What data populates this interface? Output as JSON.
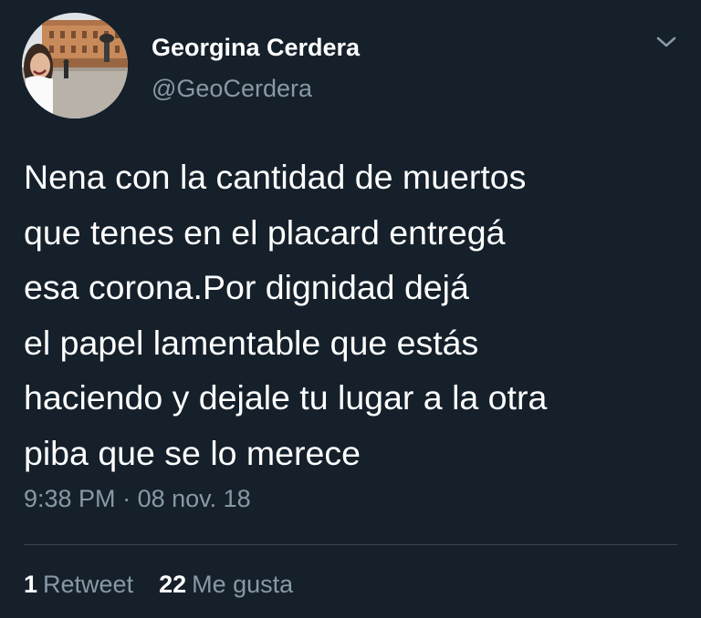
{
  "author": {
    "display_name": "Georgina Cerdera",
    "handle": "@GeoCerdera"
  },
  "tweet": {
    "text": "Nena con la cantidad de muertos\nque tenes en el placard entregá\nesa corona.Por dignidad dejá\nel papel lamentable que estás\nhaciendo y dejale tu lugar a la otra\npiba que se lo merece",
    "time": "9:38 PM",
    "separator": "·",
    "date": "08 nov. 18"
  },
  "stats": {
    "retweets_count": "1",
    "retweets_label": "Retweet",
    "likes_count": "22",
    "likes_label": "Me gusta"
  },
  "icons": {
    "menu": "chevron-down-icon"
  },
  "colors": {
    "background": "#15202b",
    "primary_text": "#ffffff",
    "secondary_text": "#8899a6",
    "divider": "#38444d"
  }
}
